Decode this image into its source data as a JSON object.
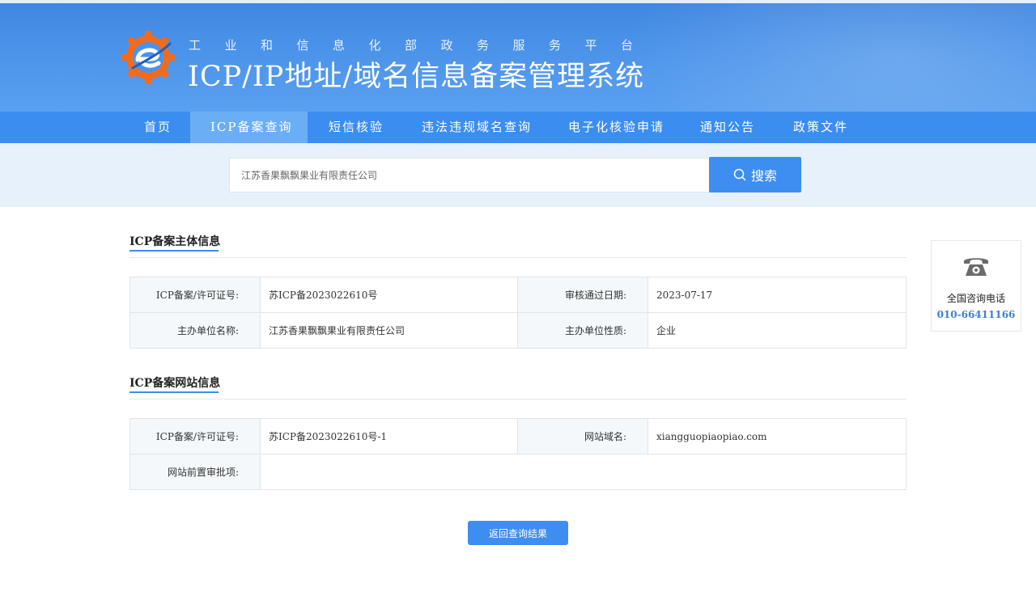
{
  "header": {
    "subtitle": "工业和信息化部政务服务平台",
    "title": "ICP/IP地址/域名信息备案管理系统"
  },
  "nav": {
    "items": [
      {
        "label": "首页"
      },
      {
        "label": "ICP备案查询",
        "active": true
      },
      {
        "label": "短信核验"
      },
      {
        "label": "违法违规域名查询"
      },
      {
        "label": "电子化核验申请"
      },
      {
        "label": "通知公告"
      },
      {
        "label": "政策文件"
      }
    ]
  },
  "search": {
    "value": "江苏香果飘飘果业有限责任公司",
    "button_label": "搜索"
  },
  "entity_section": {
    "title": "ICP备案主体信息",
    "rows": [
      {
        "label1": "ICP备案/许可证号:",
        "value1": "苏ICP备2023022610号",
        "label2": "审核通过日期:",
        "value2": "2023-07-17"
      },
      {
        "label1": "主办单位名称:",
        "value1": "江苏香果飘飘果业有限责任公司",
        "label2": "主办单位性质:",
        "value2": "企业"
      }
    ]
  },
  "website_section": {
    "title": "ICP备案网站信息",
    "row1": {
      "label1": "ICP备案/许可证号:",
      "value1": "苏ICP备2023022610号-1",
      "label2": "网站域名:",
      "value2": "xiangguopiaopiao.com"
    },
    "row2": {
      "label": "网站前置审批项:",
      "value": ""
    }
  },
  "return_button": "返回查询结果",
  "side_widget": {
    "label": "全国咨询电话",
    "phone": "010-66411166"
  },
  "colors": {
    "primary": "#3b8df0",
    "nav_active": "#6aaef5",
    "header_bg": "#4b93ea",
    "logo_orange": "#f26b1d"
  }
}
